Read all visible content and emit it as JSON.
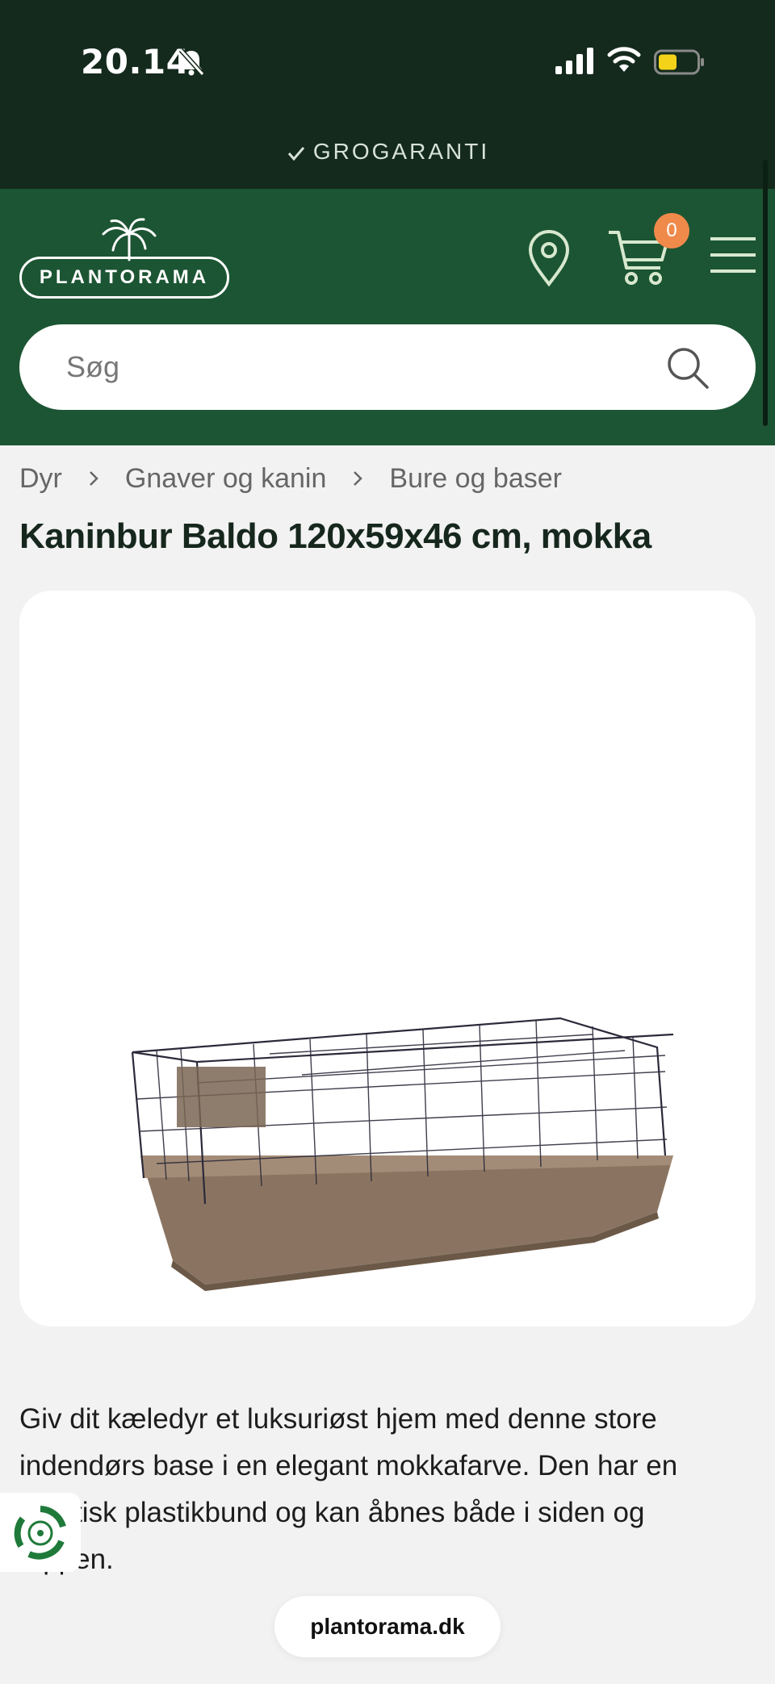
{
  "status_bar": {
    "time": "20.14",
    "icons": [
      "bell-slash-icon",
      "signal-icon",
      "wifi-icon",
      "battery-icon"
    ]
  },
  "banner": {
    "text": "GROGARANTI",
    "icon": "check-icon"
  },
  "header": {
    "logo_text": "PLANTORAMA",
    "cart_count": "0",
    "icons": [
      "location-pin-icon",
      "cart-icon",
      "hamburger-menu-icon"
    ],
    "colors": {
      "header_bg": "#1c5533",
      "top_bg": "#142a1c",
      "badge": "#f08a4b"
    }
  },
  "search": {
    "placeholder": "Søg",
    "value": ""
  },
  "breadcrumb": [
    "Dyr",
    "Gnaver og kanin",
    "Bure og baser"
  ],
  "product": {
    "title": "Kaninbur Baldo 120x59x46 cm, mokka",
    "image_alt": "rabbit-cage-image",
    "description": "Giv dit kæledyr et luksuriøst hjem med denne store indendørs base i en elegant mokkafarve. Den har en praktisk plastikbund og kan åbnes både i siden og toppen."
  },
  "browser": {
    "url": "plantorama.dk"
  }
}
